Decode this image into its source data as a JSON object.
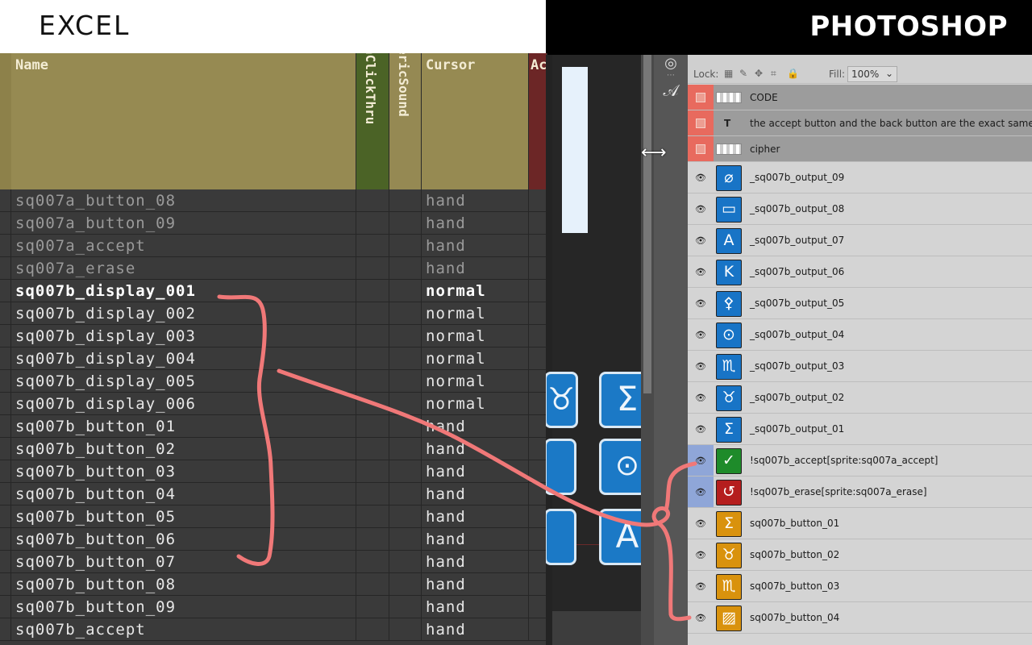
{
  "banners": {
    "excel": "EXCEL",
    "photoshop": "PHOTOSHOP"
  },
  "excel": {
    "headers": {
      "name": "Name",
      "click": "nClickThru",
      "sound": "ericSound",
      "cursor": "Cursor",
      "ac": "Ac"
    },
    "rows": [
      {
        "name": "sq007a_button_08",
        "cursor": "hand",
        "style": "dim"
      },
      {
        "name": "sq007a_button_09",
        "cursor": "hand",
        "style": "dim"
      },
      {
        "name": "sq007a_accept",
        "cursor": "hand",
        "style": "dim"
      },
      {
        "name": "sq007a_erase",
        "cursor": "hand",
        "style": "dim"
      },
      {
        "name": "sq007b_display_001",
        "cursor": "normal",
        "style": "bold"
      },
      {
        "name": "sq007b_display_002",
        "cursor": "normal",
        "style": ""
      },
      {
        "name": "sq007b_display_003",
        "cursor": "normal",
        "style": ""
      },
      {
        "name": "sq007b_display_004",
        "cursor": "normal",
        "style": ""
      },
      {
        "name": "sq007b_display_005",
        "cursor": "normal",
        "style": ""
      },
      {
        "name": "sq007b_display_006",
        "cursor": "normal",
        "style": ""
      },
      {
        "name": "sq007b_button_01",
        "cursor": "hand",
        "style": ""
      },
      {
        "name": "sq007b_button_02",
        "cursor": "hand",
        "style": ""
      },
      {
        "name": "sq007b_button_03",
        "cursor": "hand",
        "style": ""
      },
      {
        "name": "sq007b_button_04",
        "cursor": "hand",
        "style": ""
      },
      {
        "name": "sq007b_button_05",
        "cursor": "hand",
        "style": ""
      },
      {
        "name": "sq007b_button_06",
        "cursor": "hand",
        "style": ""
      },
      {
        "name": "sq007b_button_07",
        "cursor": "hand",
        "style": ""
      },
      {
        "name": "sq007b_button_08",
        "cursor": "hand",
        "style": ""
      },
      {
        "name": "sq007b_button_09",
        "cursor": "hand",
        "style": ""
      },
      {
        "name": "sq007b_accept",
        "cursor": "hand",
        "style": ""
      }
    ]
  },
  "photoshop": {
    "canvas_buttons": [
      "♉",
      "Σ",
      "",
      "⊙",
      "",
      "A"
    ],
    "tool_icon": "𝒜",
    "lockbar": {
      "lock_label": "Lock:",
      "fill_label": "Fill:",
      "fill_value": "100%",
      "fill_arrow": "⌄"
    },
    "layers": [
      {
        "name": "CODE",
        "kind": "group-raster"
      },
      {
        "name": "the accept button and the back button are the exact same a...",
        "kind": "group-text"
      },
      {
        "name": "cipher",
        "kind": "group-raster"
      },
      {
        "name": "_sq007b_output_09",
        "kind": "normal",
        "thumb_color": "blue",
        "glyph": "⌀"
      },
      {
        "name": "_sq007b_output_08",
        "kind": "normal",
        "thumb_color": "blue",
        "glyph": "▭"
      },
      {
        "name": "_sq007b_output_07",
        "kind": "normal",
        "thumb_color": "blue",
        "glyph": "A"
      },
      {
        "name": "_sq007b_output_06",
        "kind": "normal",
        "thumb_color": "blue",
        "glyph": "K"
      },
      {
        "name": "_sq007b_output_05",
        "kind": "normal",
        "thumb_color": "blue",
        "glyph": "⚴"
      },
      {
        "name": "_sq007b_output_04",
        "kind": "normal",
        "thumb_color": "blue",
        "glyph": "⊙"
      },
      {
        "name": "_sq007b_output_03",
        "kind": "normal",
        "thumb_color": "blue",
        "glyph": "♏"
      },
      {
        "name": "_sq007b_output_02",
        "kind": "normal",
        "thumb_color": "blue",
        "glyph": "♉"
      },
      {
        "name": "_sq007b_output_01",
        "kind": "normal",
        "thumb_color": "blue",
        "glyph": "Σ"
      },
      {
        "name": "!sq007b_accept[sprite:sq007a_accept]",
        "kind": "selected",
        "thumb_color": "green",
        "glyph": "✓"
      },
      {
        "name": "!sq007b_erase[sprite:sq007a_erase]",
        "kind": "selected",
        "thumb_color": "red",
        "glyph": "↺"
      },
      {
        "name": "sq007b_button_01",
        "kind": "normal",
        "thumb_color": "orange",
        "glyph": "Σ"
      },
      {
        "name": "sq007b_button_02",
        "kind": "normal",
        "thumb_color": "orange",
        "glyph": "♉"
      },
      {
        "name": "sq007b_button_03",
        "kind": "normal",
        "thumb_color": "orange",
        "glyph": "♏"
      },
      {
        "name": "sq007b_button_04",
        "kind": "normal",
        "thumb_color": "orange",
        "glyph": "▨"
      }
    ]
  },
  "colors": {
    "annotation": "#f07878",
    "excel_header": "#968a52",
    "excel_header_green": "#4b6326",
    "excel_header_red": "#6c2626",
    "ps_group_marker": "#e86a5e",
    "ps_selected_marker": "#8fa6d8"
  }
}
